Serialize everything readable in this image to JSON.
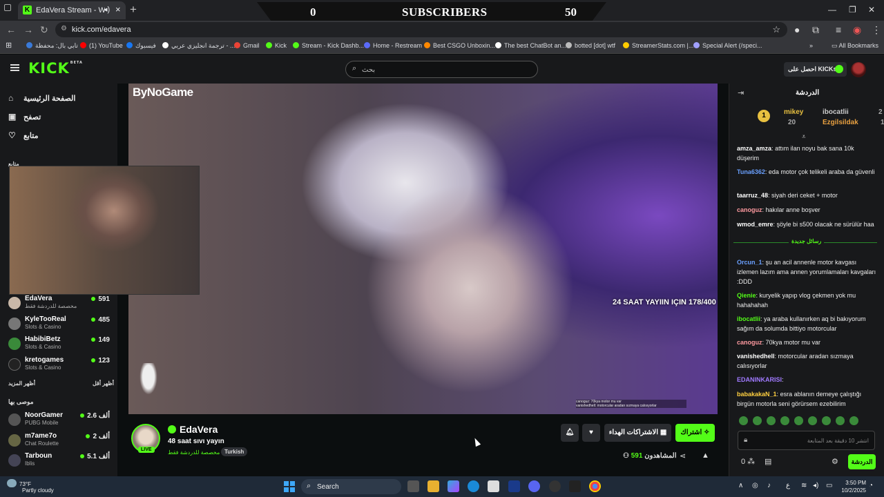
{
  "browser": {
    "tab_title": "EdaVera Stream - Watch Li",
    "url": "kick.com/edavera",
    "bookmarks": [
      "تابي بال: محفظة",
      "(1) YouTube",
      "فيسبوك",
      "ترجمة انجليزي عربي - ...",
      "Gmail",
      "Kick",
      "Stream - Kick Dashb...",
      "Home - Restream",
      "Best CSGO Unboxin...",
      "The best ChatBot an...",
      "botted [dot] wtf",
      "StreamerStats.com |...",
      "Special Alert (/speci..."
    ],
    "all_bookmarks": "All Bookmarks"
  },
  "subscriber_banner": {
    "left": "0",
    "label": "SUBSCRIBERS",
    "right": "50"
  },
  "header": {
    "logo": "KICK",
    "logo_sup": "BETA",
    "search_placeholder": "بحث",
    "kicks_button": "احصل على KICKs"
  },
  "sidebar": {
    "nav": [
      "الصفحة الرئيسية",
      "تصفح",
      "متابع"
    ],
    "following_label": "متابع",
    "channels": [
      {
        "name": "EdaVera",
        "category": "مخصصة للدردشة فقط",
        "viewers": "591",
        "color": "#c9b8a8"
      },
      {
        "name": "KyleTooReal",
        "category": "Slots & Casino",
        "viewers": "485",
        "color": "#777"
      },
      {
        "name": "HabibiBetz",
        "category": "Slots & Casino",
        "viewers": "149",
        "color": "#3a8a3a"
      },
      {
        "name": "kretogames",
        "category": "Slots & Casino",
        "viewers": "123",
        "color": "#222"
      }
    ],
    "show_more": "أظهر المزيد",
    "show_less": "أظهر أقل",
    "recommended_label": "موصى بها",
    "recommended": [
      {
        "name": "NoorGamer",
        "category": "PUBG Mobile",
        "viewers": "2.6 ألف",
        "color": "#555"
      },
      {
        "name": "m7ame7o",
        "category": "Chat Roulette",
        "viewers": "2 ألف",
        "color": "#664"
      },
      {
        "name": "Tarboun",
        "category": "Iblis",
        "viewers": "5.1 ألف",
        "color": "#445"
      }
    ]
  },
  "video": {
    "watermark": "ByNoGame",
    "overlay_text": "24 SAAT YAYIIN IÇIN 178/400",
    "mini_chat": [
      "canoguz: 70kya motor mu var",
      "vanishedhell: motorcular aradan sızmaya calısıyorlar"
    ]
  },
  "stream_info": {
    "name": "EdaVera",
    "live": "LIVE",
    "title": "48 saat sıvı yayın",
    "category": "مخصصة للدردشة فقط",
    "tag": "Turkish",
    "follow_button": "اشتراك",
    "gift_button": "الاشتراكات الهداء",
    "viewers_label": "المشاهدون",
    "viewers_count": "591"
  },
  "chat": {
    "title": "الدردشة",
    "leaderboard": [
      {
        "name": "mikey",
        "count": "20",
        "color": "#e8c040"
      },
      {
        "name": "ibocatlii",
        "count": "2",
        "color": "#ccc"
      },
      {
        "name": "Ezgilsildak",
        "count": "1",
        "color": "#e8a040"
      }
    ],
    "messages_top": [
      {
        "user": "amza_amza",
        "text": "attım ilan noyu bak sana 10k düşerim",
        "color": "#fff"
      },
      {
        "user": "Tuna6362",
        "text": "eda motor çok telikeli araba da güvenli",
        "color": "#6aa0ff"
      },
      {
        "user": "taarruz_48",
        "text": "siyah deri ceket + motor",
        "color": "#fff"
      },
      {
        "user": "canoguz",
        "text": "hakılar anne boşver",
        "color": "#ff9aa0"
      },
      {
        "user": "wmod_emre",
        "text": "şöyle bi s500 olacak ne sürülür haa",
        "color": "#fff"
      }
    ],
    "new_messages": "رسائل جديدة",
    "messages_bottom": [
      {
        "user": "Orcun_1",
        "text": "şu an acil annenle motor kavgası izlemen lazım ama annen yorumlamaları kavgaları :DDD",
        "color": "#6aa0ff"
      },
      {
        "user": "Qienie",
        "text": "kuryelik yapıp vlog çekmen yok mu hahahahah",
        "color": "#53fc18"
      },
      {
        "user": "ibocatlii",
        "text": "ya araba kullanırken aq bi bakıyorum sağım da solumda bittiyo motorcular",
        "color": "#53fc18"
      },
      {
        "user": "canoguz",
        "text": "70kya motor mu var",
        "color": "#ff9aa0"
      },
      {
        "user": "vanishedhell",
        "text": "motorcular aradan sızmaya calısıyorlar",
        "color": "#fff"
      },
      {
        "user": "EDANINKARISI",
        "text": "",
        "color": "#a07aff"
      },
      {
        "user": "babakakaN_1",
        "text": "esra ablanın demeye çalıştığı birgün motorla seni görürsem ezebilirim",
        "color": "#ffd040"
      }
    ],
    "input_placeholder": "انتشر 10 دقيقة بعد المتابعة",
    "send_button": "الدردشة",
    "points": "0"
  },
  "taskbar": {
    "temp": "73°F",
    "weather": "Partly cloudy",
    "search": "Search",
    "time": "3:50 PM",
    "date": "10/2/2025"
  }
}
